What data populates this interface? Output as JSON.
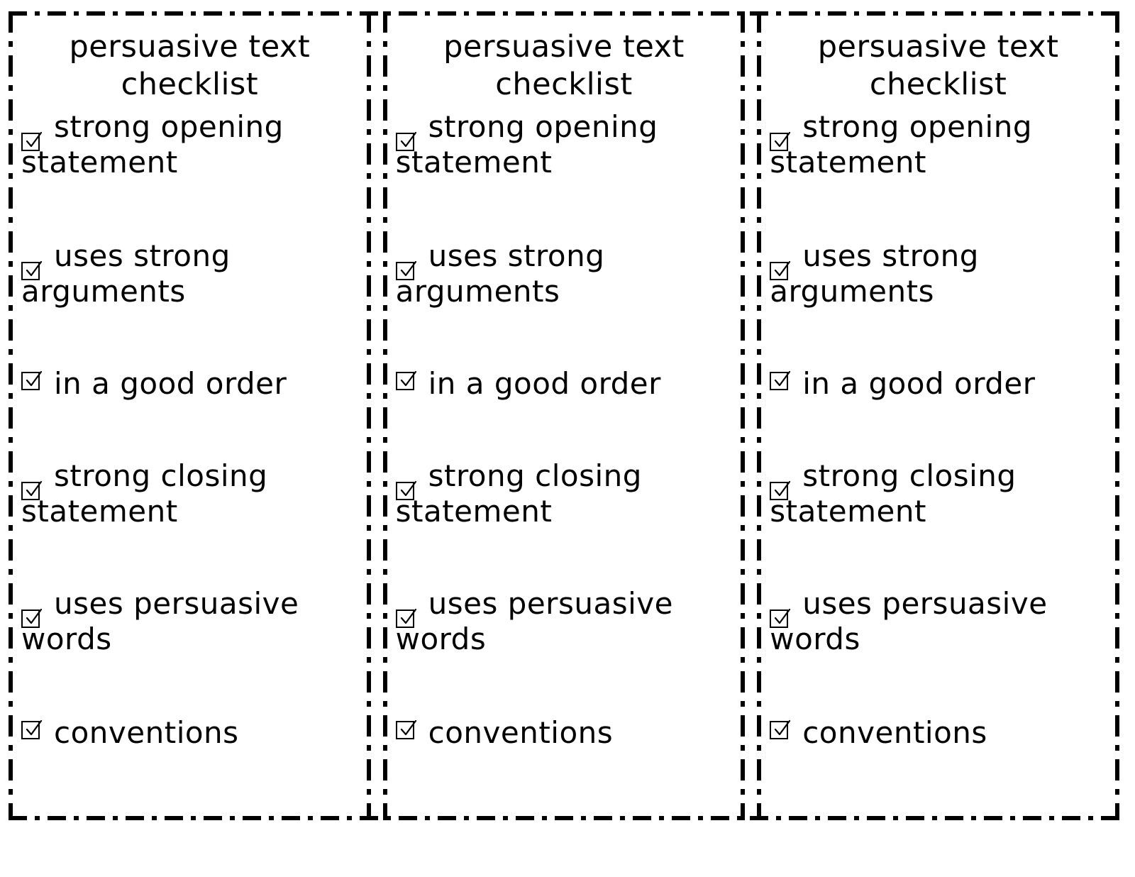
{
  "document": {
    "kind": "printable-checklist-worksheet",
    "card_count": 3,
    "title_line1": "persuasive text",
    "title_line2": "checklist",
    "title_full": "persuasive text checklist",
    "checkbox_glyph": "ballot-box-with-check",
    "ink_color": "#000000",
    "paper_color": "#ffffff",
    "border_style": "dash-dot cutting guide"
  },
  "checklist": {
    "items": [
      {
        "id": "strong-opening-statement",
        "line1": "strong opening",
        "line2": "statement",
        "text": "strong opening statement",
        "checked": true
      },
      {
        "id": "uses-strong-arguments",
        "line1": "uses strong",
        "line2": "arguments",
        "text": "uses strong arguments",
        "checked": true
      },
      {
        "id": "in-a-good-order",
        "line1": "in a good order",
        "line2": "",
        "text": "in a good order",
        "checked": true
      },
      {
        "id": "strong-closing-statement",
        "line1": "strong closing",
        "line2": "statement",
        "text": "strong closing statement",
        "checked": true
      },
      {
        "id": "uses-persuasive-words",
        "line1": "uses persuasive",
        "line2": "words",
        "text": "uses persuasive words",
        "checked": true
      },
      {
        "id": "conventions",
        "line1": "conventions",
        "line2": "",
        "text": "conventions",
        "checked": true
      }
    ]
  },
  "cards": [
    {
      "index": 1,
      "label": "card-left"
    },
    {
      "index": 2,
      "label": "card-middle"
    },
    {
      "index": 3,
      "label": "card-right"
    }
  ]
}
